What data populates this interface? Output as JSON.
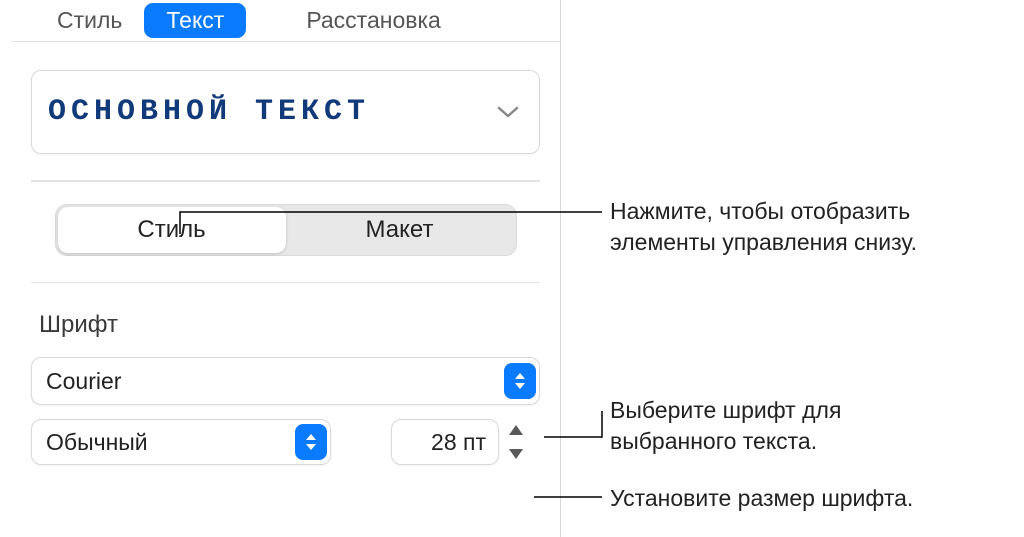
{
  "tabs": {
    "style": "Стиль",
    "text": "Текст",
    "arrangement": "Расстановка"
  },
  "paragraph_style": {
    "label": "ОСНОВНОЙ ТЕКСТ"
  },
  "segmented": {
    "style": "Стиль",
    "layout": "Макет"
  },
  "font_section": {
    "heading": "Шрифт",
    "font_family": "Courier",
    "font_weight": "Обычный",
    "font_size": "28 пт"
  },
  "callouts": {
    "c1": "Нажмите, чтобы отобразить\nэлементы управления снизу.",
    "c2": "Выберите шрифт для\nвыбранного текста.",
    "c3": "Установите размер шрифта."
  }
}
